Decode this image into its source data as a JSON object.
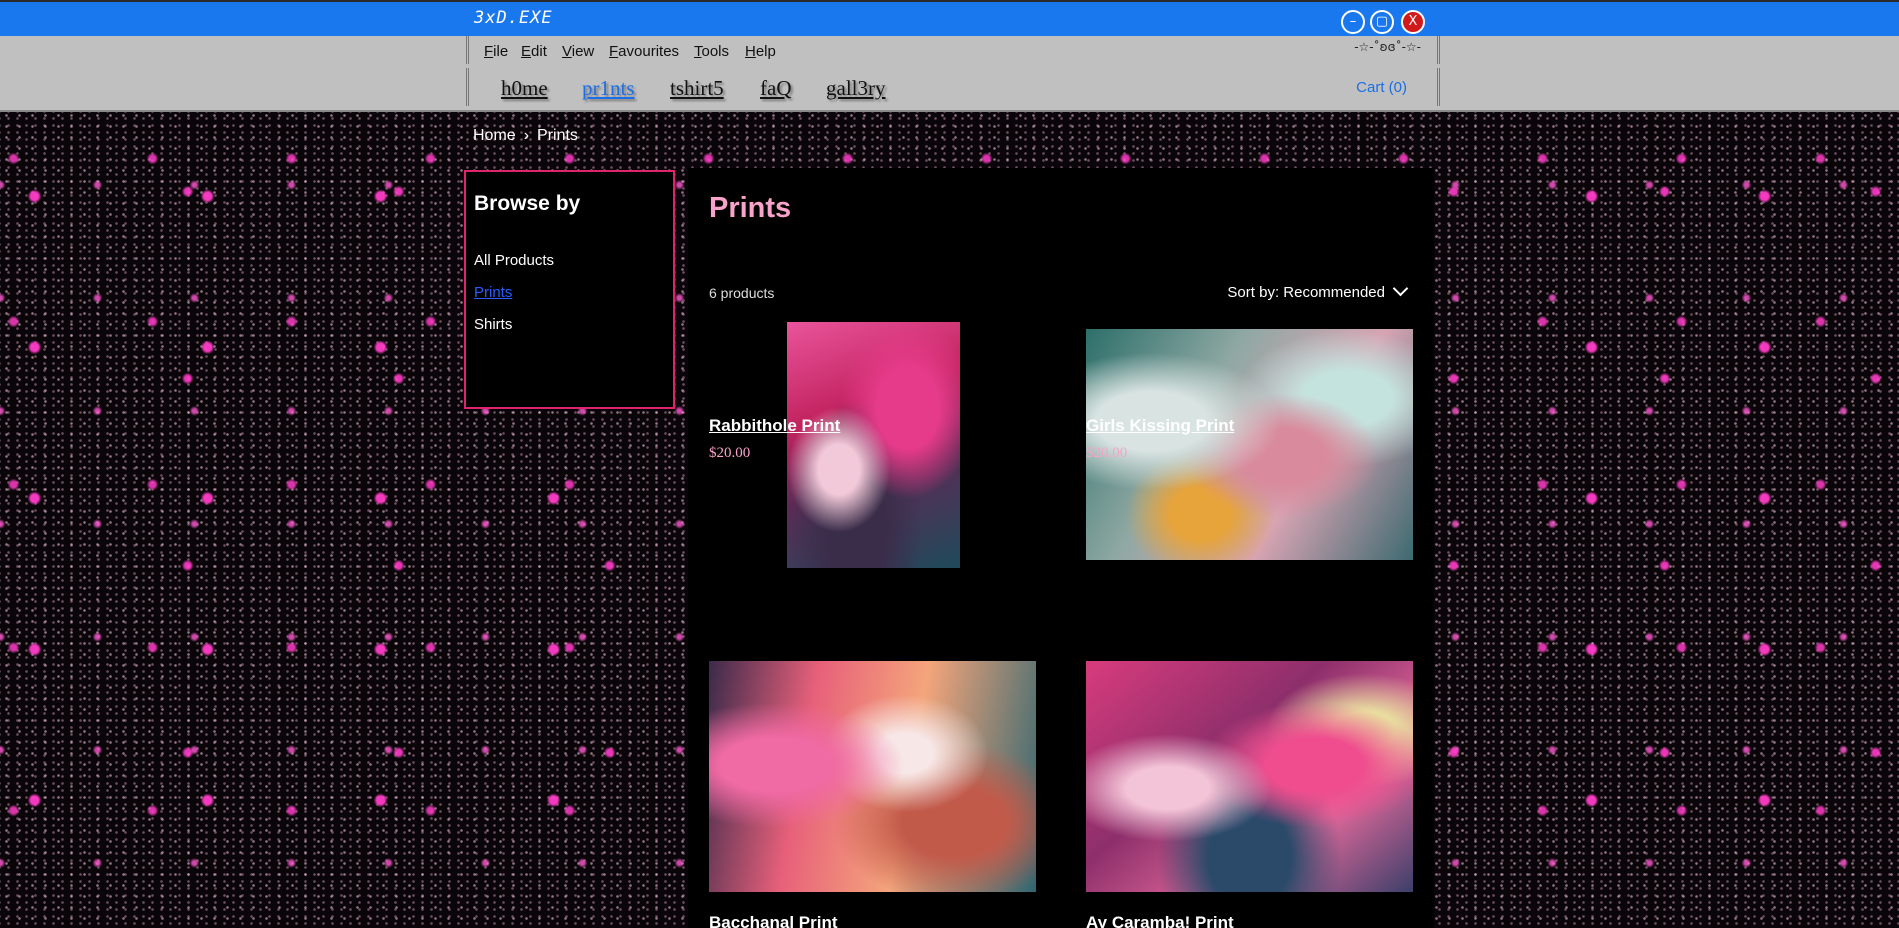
{
  "window": {
    "title": "3xD.EXE",
    "buttons": {
      "minimize": "–",
      "maximize": "▢",
      "close": "X"
    }
  },
  "menubar": {
    "items": [
      {
        "label": "File",
        "accel": "F",
        "rest": "ile"
      },
      {
        "label": "Edit",
        "accel": "E",
        "rest": "dit"
      },
      {
        "label": "View",
        "accel": "V",
        "rest": "iew"
      },
      {
        "label": "Favourites",
        "accel": "F",
        "rest": "avourites"
      },
      {
        "label": "Tools",
        "accel": "T",
        "rest": "ools"
      },
      {
        "label": "Help",
        "accel": "H",
        "rest": "elp"
      }
    ],
    "decoration": "-☆-˚ʚɞ˚-☆-"
  },
  "nav": {
    "links": [
      "h0me",
      "pr1nts",
      "tshirt5",
      "faQ",
      "gall3ry"
    ],
    "active": "pr1nts",
    "cart": "Cart (0)"
  },
  "breadcrumb": {
    "home": "Home",
    "current": "Prints"
  },
  "sidebar": {
    "title": "Browse by",
    "items": [
      "All Products",
      "Prints",
      "Shirts"
    ],
    "active": "Prints"
  },
  "main": {
    "title": "Prints",
    "count": "6 products",
    "sort": "Sort by: Recommended"
  },
  "products": [
    {
      "name": "Rabbithole Print",
      "price": "$20.00"
    },
    {
      "name": "Girls Kissing Print",
      "price": "$20.00"
    },
    {
      "name": "Bacchanal Print",
      "price": ""
    },
    {
      "name": "Ay Caramba! Print",
      "price": ""
    }
  ],
  "colors": {
    "titlebar": "#1a78ef",
    "accent_pink": "#f8a3c9",
    "sidebar_border": "#e0246b",
    "link_blue": "#1a6fe8"
  }
}
